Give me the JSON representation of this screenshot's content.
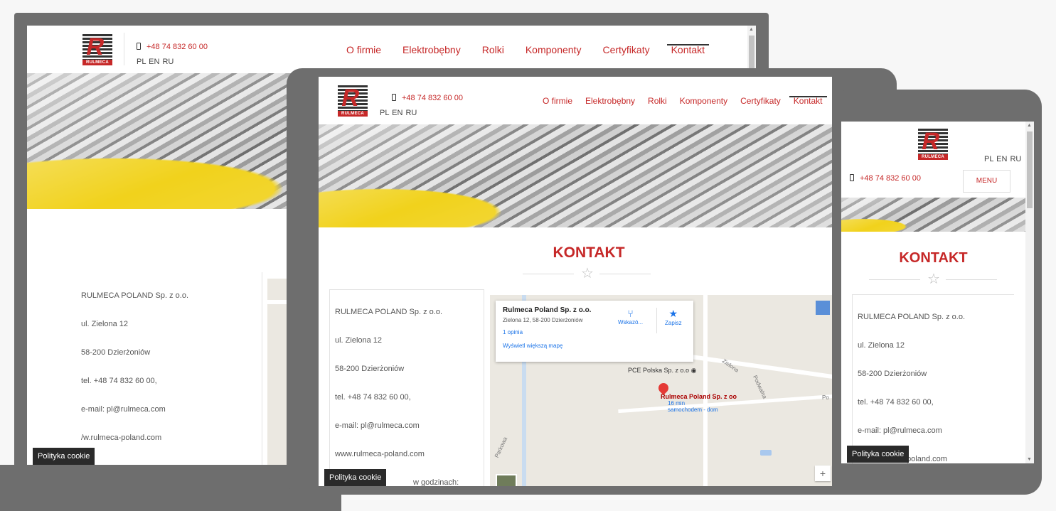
{
  "site": {
    "phone": "+48 74 832 60 00",
    "languages": "PL EN RU",
    "logo_text": "RULMECA",
    "nav": [
      "O firmie",
      "Elektrobębny",
      "Rolki",
      "Komponenty",
      "Certyfikaty",
      "Kontakt"
    ],
    "menu_label": "MENU",
    "page_title": "KONTAKT",
    "cookie": "Polityka cookie",
    "contact": {
      "company": "RULMECA POLAND Sp. z o.o.",
      "street": "ul. Zielona 12",
      "city": "58-200 Dzierżoniów",
      "tel": "tel. +48 74 832 60 00,",
      "email": "e-mail: pl@rulmeca.com",
      "www": "www.rulmeca-poland.com",
      "hours": "w godzinach:",
      "www_partial": "/w.rulmeca-poland.com"
    }
  },
  "map": {
    "place_name": "Rulmeca Poland Sp. z o.o.",
    "place_address": "Zielona 12, 58-200 Dzierżoniów",
    "reviews": "1 opinia",
    "larger_map": "Wyświetl większą mapę",
    "directions": "Wskazó...",
    "save": "Zapisz",
    "poi": "PCE Polska Sp. z o.o",
    "pin_label": "Rulmeca Poland Sp. z oo",
    "pin_sub1": "16 min",
    "pin_sub2": "samochodem - dom",
    "street1": "Zielona",
    "street2": "Podwalna",
    "street3": "Parkowa",
    "street4": "Po",
    "zoom": "+"
  },
  "colors": {
    "brand_red": "#c62828",
    "frame_gray": "#6e6e6e"
  }
}
